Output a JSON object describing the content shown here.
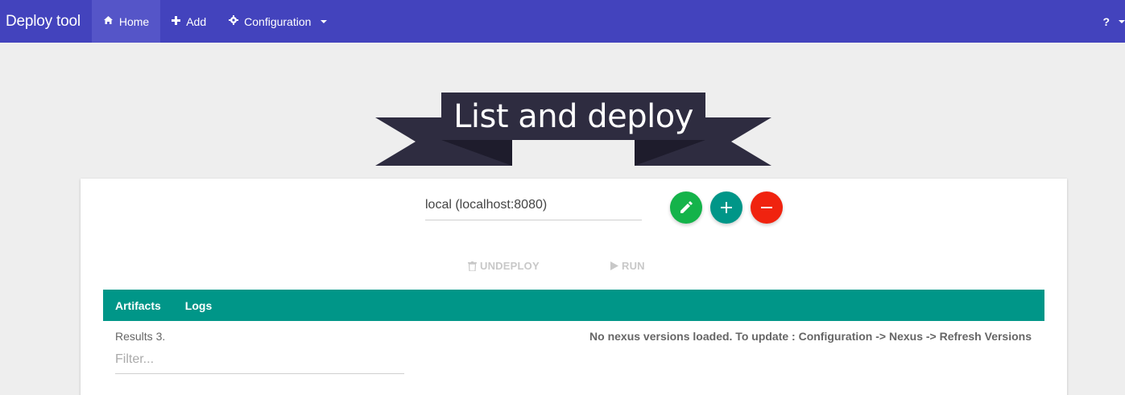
{
  "navbar": {
    "brand": "Deploy tool",
    "home_label": "Home",
    "add_label": "Add",
    "configuration_label": "Configuration",
    "help_label": "?"
  },
  "banner": {
    "title": "List and deploy"
  },
  "environment": {
    "selected": "local (localhost:8080)"
  },
  "actions": {
    "undeploy_label": "UNDEPLOY",
    "run_label": "RUN"
  },
  "tabs": [
    {
      "label": "Artifacts"
    },
    {
      "label": "Logs"
    }
  ],
  "results": {
    "count_text": "Results 3.",
    "nexus_message": "No nexus versions loaded. To update : Configuration -> Nexus -> Refresh Versions",
    "filter_placeholder": "Filter..."
  },
  "colors": {
    "navbar": "#4343bd",
    "teal": "#009688",
    "edit_green": "#14b34a",
    "remove_red": "#f0230f",
    "ribbon": "#2e2c40"
  }
}
